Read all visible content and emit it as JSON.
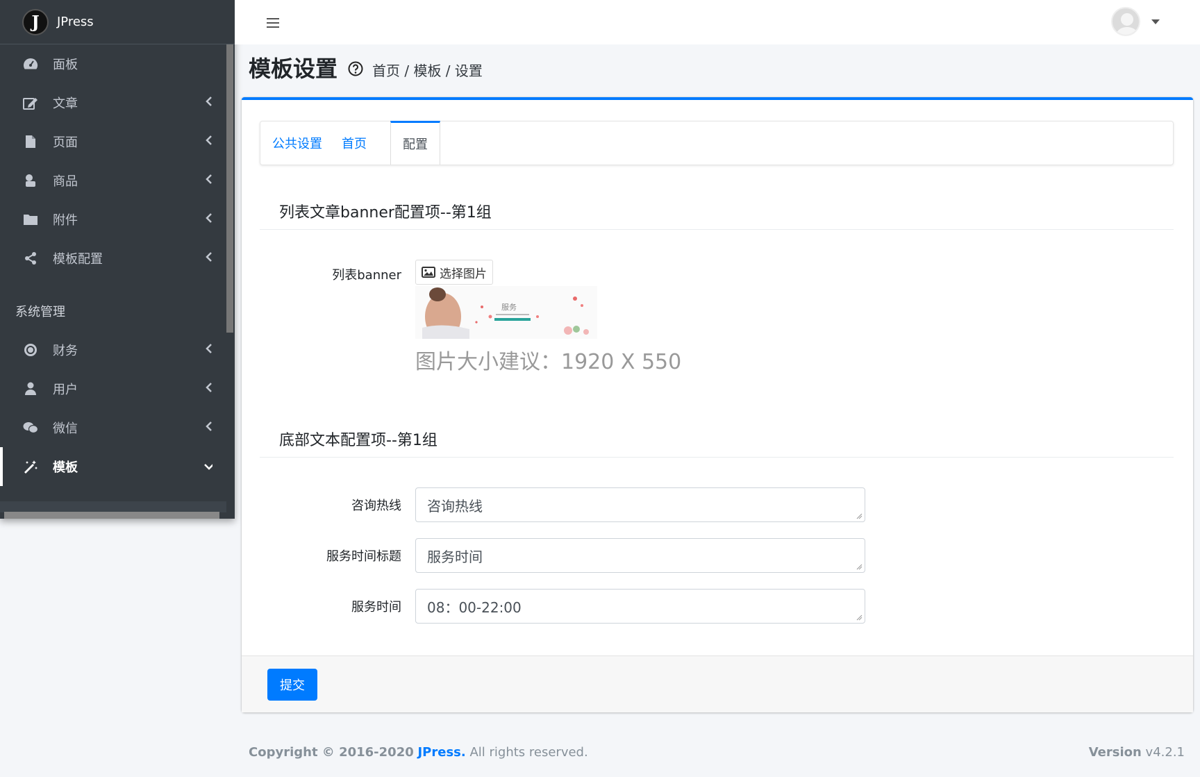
{
  "brand": {
    "name": "JPress",
    "logo_letter": "J"
  },
  "sidebar": {
    "items": [
      {
        "label": "面板",
        "icon": "dashboard-icon",
        "has_children": false
      },
      {
        "label": "文章",
        "icon": "edit-icon",
        "has_children": true
      },
      {
        "label": "页面",
        "icon": "file-icon",
        "has_children": true
      },
      {
        "label": "商品",
        "icon": "product-icon",
        "has_children": true
      },
      {
        "label": "附件",
        "icon": "folder-icon",
        "has_children": true
      },
      {
        "label": "模板配置",
        "icon": "share-icon",
        "has_children": true
      }
    ],
    "section_header": "系统管理",
    "system_items": [
      {
        "label": "财务",
        "icon": "finance-icon",
        "has_children": true
      },
      {
        "label": "用户",
        "icon": "user-icon",
        "has_children": true
      },
      {
        "label": "微信",
        "icon": "wechat-icon",
        "has_children": true
      },
      {
        "label": "模板",
        "icon": "magic-wand-icon",
        "has_children": true,
        "active": true
      }
    ]
  },
  "header": {
    "title": "模板设置",
    "breadcrumb": "首页 / 模板 / 设置"
  },
  "tabs": [
    {
      "label": "公共设置",
      "active": false
    },
    {
      "label": "首页",
      "active": false
    },
    {
      "label": "配置",
      "active": true
    }
  ],
  "sections": {
    "banner": {
      "title": "列表文章banner配置项--第1组",
      "field_label": "列表banner",
      "select_button": "选择图片",
      "banner_text": "服务",
      "size_hint": "图片大小建议：1920 X 550"
    },
    "footer_text": {
      "title": "底部文本配置项--第1组",
      "fields": [
        {
          "label": "咨询热线",
          "value": "咨询热线"
        },
        {
          "label": "服务时间标题",
          "value": "服务时间"
        },
        {
          "label": "服务时间",
          "value": "08：00-22:00"
        }
      ]
    }
  },
  "submit_label": "提交",
  "footer": {
    "copyright_prefix": "Copyright © 2016-2020",
    "brand_link": "JPress.",
    "rights": "All rights reserved.",
    "version_label": "Version",
    "version_number": "v4.2.1"
  },
  "colors": {
    "accent": "#007bff",
    "sidebar_bg": "#343a40",
    "page_bg": "#f4f6f9"
  }
}
